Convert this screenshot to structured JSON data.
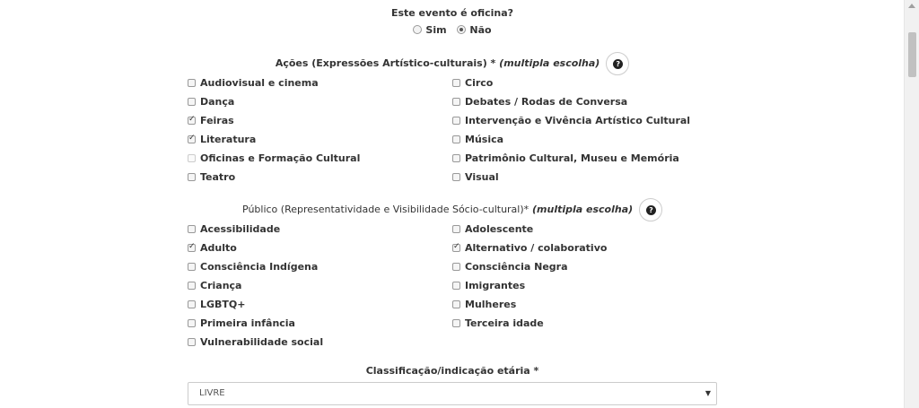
{
  "oficina": {
    "question": "Este evento é oficina?",
    "options": [
      {
        "label": "Sim",
        "selected": false
      },
      {
        "label": "Não",
        "selected": true
      }
    ]
  },
  "acoes": {
    "title": "Ações (Expressões Artístico-culturais) *",
    "multi": "(multipla escolha)",
    "help_icon": "question-circle-icon",
    "items": [
      {
        "label": "Audiovisual e cinema",
        "checked": false,
        "disabled": false
      },
      {
        "label": "Circo",
        "checked": false,
        "disabled": false
      },
      {
        "label": "Dança",
        "checked": false,
        "disabled": false
      },
      {
        "label": "Debates / Rodas de Conversa",
        "checked": false,
        "disabled": false
      },
      {
        "label": "Feiras",
        "checked": true,
        "disabled": false
      },
      {
        "label": "Intervenção e Vivência Artístico Cultural",
        "checked": false,
        "disabled": false
      },
      {
        "label": "Literatura",
        "checked": true,
        "disabled": false
      },
      {
        "label": "Música",
        "checked": false,
        "disabled": false
      },
      {
        "label": "Oficinas e Formação Cultural",
        "checked": false,
        "disabled": true
      },
      {
        "label": "Patrimônio Cultural, Museu e Memória",
        "checked": false,
        "disabled": false
      },
      {
        "label": "Teatro",
        "checked": false,
        "disabled": false
      },
      {
        "label": "Visual",
        "checked": false,
        "disabled": false
      }
    ]
  },
  "publico": {
    "title": "Público (Representatividade e Visibilidade Sócio-cultural)*",
    "multi": "(multipla escolha)",
    "help_icon": "question-circle-icon",
    "items": [
      {
        "label": "Acessibilidade",
        "checked": false,
        "disabled": false
      },
      {
        "label": "Adolescente",
        "checked": false,
        "disabled": false
      },
      {
        "label": "Adulto",
        "checked": true,
        "disabled": false
      },
      {
        "label": "Alternativo / colaborativo",
        "checked": true,
        "disabled": false
      },
      {
        "label": "Consciência Indígena",
        "checked": false,
        "disabled": false
      },
      {
        "label": "Consciência Negra",
        "checked": false,
        "disabled": false
      },
      {
        "label": "Criança",
        "checked": false,
        "disabled": false
      },
      {
        "label": "Imigrantes",
        "checked": false,
        "disabled": false
      },
      {
        "label": "LGBTQ+",
        "checked": false,
        "disabled": false
      },
      {
        "label": "Mulheres",
        "checked": false,
        "disabled": false
      },
      {
        "label": "Primeira infância",
        "checked": false,
        "disabled": false
      },
      {
        "label": "Terceira idade",
        "checked": false,
        "disabled": false
      },
      {
        "label": "Vulnerabilidade social",
        "checked": false,
        "disabled": false
      }
    ]
  },
  "classificacao": {
    "label": "Classificação/indicação etária *",
    "selected": "LIVRE",
    "arrow_icon": "dropdown-arrow-icon"
  }
}
